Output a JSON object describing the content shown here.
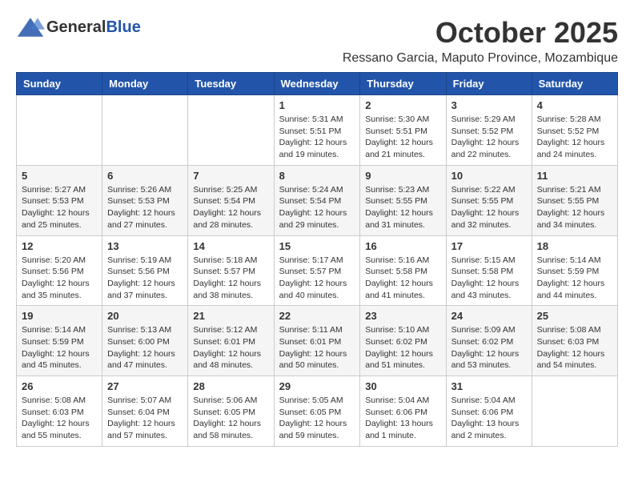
{
  "header": {
    "logo_general": "General",
    "logo_blue": "Blue",
    "month_title": "October 2025",
    "subtitle": "Ressano Garcia, Maputo Province, Mozambique"
  },
  "days_of_week": [
    "Sunday",
    "Monday",
    "Tuesday",
    "Wednesday",
    "Thursday",
    "Friday",
    "Saturday"
  ],
  "weeks": [
    [
      {
        "day": "",
        "content": ""
      },
      {
        "day": "",
        "content": ""
      },
      {
        "day": "",
        "content": ""
      },
      {
        "day": "1",
        "content": "Sunrise: 5:31 AM\nSunset: 5:51 PM\nDaylight: 12 hours\nand 19 minutes."
      },
      {
        "day": "2",
        "content": "Sunrise: 5:30 AM\nSunset: 5:51 PM\nDaylight: 12 hours\nand 21 minutes."
      },
      {
        "day": "3",
        "content": "Sunrise: 5:29 AM\nSunset: 5:52 PM\nDaylight: 12 hours\nand 22 minutes."
      },
      {
        "day": "4",
        "content": "Sunrise: 5:28 AM\nSunset: 5:52 PM\nDaylight: 12 hours\nand 24 minutes."
      }
    ],
    [
      {
        "day": "5",
        "content": "Sunrise: 5:27 AM\nSunset: 5:53 PM\nDaylight: 12 hours\nand 25 minutes."
      },
      {
        "day": "6",
        "content": "Sunrise: 5:26 AM\nSunset: 5:53 PM\nDaylight: 12 hours\nand 27 minutes."
      },
      {
        "day": "7",
        "content": "Sunrise: 5:25 AM\nSunset: 5:54 PM\nDaylight: 12 hours\nand 28 minutes."
      },
      {
        "day": "8",
        "content": "Sunrise: 5:24 AM\nSunset: 5:54 PM\nDaylight: 12 hours\nand 29 minutes."
      },
      {
        "day": "9",
        "content": "Sunrise: 5:23 AM\nSunset: 5:55 PM\nDaylight: 12 hours\nand 31 minutes."
      },
      {
        "day": "10",
        "content": "Sunrise: 5:22 AM\nSunset: 5:55 PM\nDaylight: 12 hours\nand 32 minutes."
      },
      {
        "day": "11",
        "content": "Sunrise: 5:21 AM\nSunset: 5:55 PM\nDaylight: 12 hours\nand 34 minutes."
      }
    ],
    [
      {
        "day": "12",
        "content": "Sunrise: 5:20 AM\nSunset: 5:56 PM\nDaylight: 12 hours\nand 35 minutes."
      },
      {
        "day": "13",
        "content": "Sunrise: 5:19 AM\nSunset: 5:56 PM\nDaylight: 12 hours\nand 37 minutes."
      },
      {
        "day": "14",
        "content": "Sunrise: 5:18 AM\nSunset: 5:57 PM\nDaylight: 12 hours\nand 38 minutes."
      },
      {
        "day": "15",
        "content": "Sunrise: 5:17 AM\nSunset: 5:57 PM\nDaylight: 12 hours\nand 40 minutes."
      },
      {
        "day": "16",
        "content": "Sunrise: 5:16 AM\nSunset: 5:58 PM\nDaylight: 12 hours\nand 41 minutes."
      },
      {
        "day": "17",
        "content": "Sunrise: 5:15 AM\nSunset: 5:58 PM\nDaylight: 12 hours\nand 43 minutes."
      },
      {
        "day": "18",
        "content": "Sunrise: 5:14 AM\nSunset: 5:59 PM\nDaylight: 12 hours\nand 44 minutes."
      }
    ],
    [
      {
        "day": "19",
        "content": "Sunrise: 5:14 AM\nSunset: 5:59 PM\nDaylight: 12 hours\nand 45 minutes."
      },
      {
        "day": "20",
        "content": "Sunrise: 5:13 AM\nSunset: 6:00 PM\nDaylight: 12 hours\nand 47 minutes."
      },
      {
        "day": "21",
        "content": "Sunrise: 5:12 AM\nSunset: 6:01 PM\nDaylight: 12 hours\nand 48 minutes."
      },
      {
        "day": "22",
        "content": "Sunrise: 5:11 AM\nSunset: 6:01 PM\nDaylight: 12 hours\nand 50 minutes."
      },
      {
        "day": "23",
        "content": "Sunrise: 5:10 AM\nSunset: 6:02 PM\nDaylight: 12 hours\nand 51 minutes."
      },
      {
        "day": "24",
        "content": "Sunrise: 5:09 AM\nSunset: 6:02 PM\nDaylight: 12 hours\nand 53 minutes."
      },
      {
        "day": "25",
        "content": "Sunrise: 5:08 AM\nSunset: 6:03 PM\nDaylight: 12 hours\nand 54 minutes."
      }
    ],
    [
      {
        "day": "26",
        "content": "Sunrise: 5:08 AM\nSunset: 6:03 PM\nDaylight: 12 hours\nand 55 minutes."
      },
      {
        "day": "27",
        "content": "Sunrise: 5:07 AM\nSunset: 6:04 PM\nDaylight: 12 hours\nand 57 minutes."
      },
      {
        "day": "28",
        "content": "Sunrise: 5:06 AM\nSunset: 6:05 PM\nDaylight: 12 hours\nand 58 minutes."
      },
      {
        "day": "29",
        "content": "Sunrise: 5:05 AM\nSunset: 6:05 PM\nDaylight: 12 hours\nand 59 minutes."
      },
      {
        "day": "30",
        "content": "Sunrise: 5:04 AM\nSunset: 6:06 PM\nDaylight: 13 hours\nand 1 minute."
      },
      {
        "day": "31",
        "content": "Sunrise: 5:04 AM\nSunset: 6:06 PM\nDaylight: 13 hours\nand 2 minutes."
      },
      {
        "day": "",
        "content": ""
      }
    ]
  ]
}
